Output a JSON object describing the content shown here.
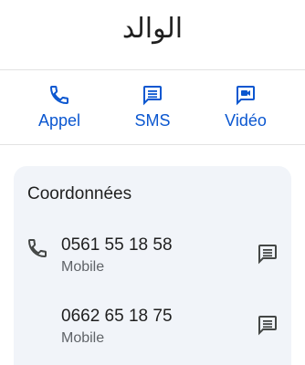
{
  "contact": {
    "name": "الوالد"
  },
  "actions": [
    {
      "label": "Appel",
      "icon": "phone-icon"
    },
    {
      "label": "SMS",
      "icon": "message-icon"
    },
    {
      "label": "Vidéo",
      "icon": "video-icon"
    }
  ],
  "details": {
    "title": "Coordonnées",
    "phones": [
      {
        "number": "0561 55 18 58",
        "type": "Mobile"
      },
      {
        "number": "0662 65 18 75",
        "type": "Mobile"
      }
    ]
  },
  "colors": {
    "accent": "#0b57d0",
    "card_bg": "#f1f4f9",
    "text": "#1f1f1f",
    "secondary": "#5f6368"
  }
}
